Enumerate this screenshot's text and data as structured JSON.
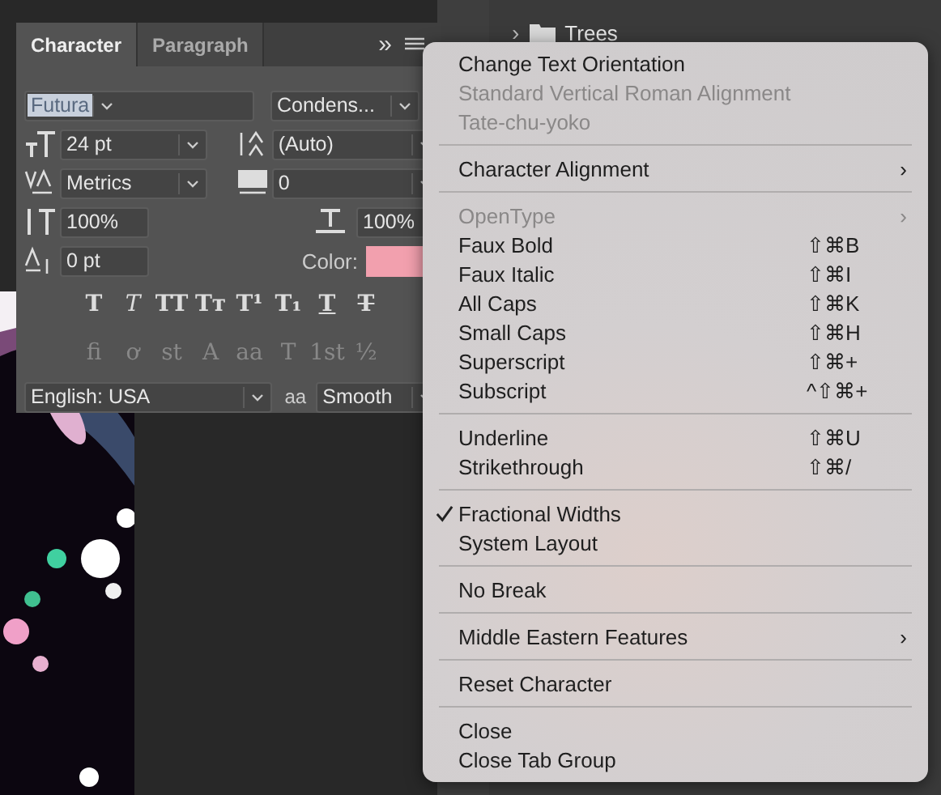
{
  "layers": {
    "rows": [
      {
        "label": "Trees",
        "chevron": "›"
      }
    ]
  },
  "character_panel": {
    "tabs": [
      {
        "label": "Character",
        "selected": true
      },
      {
        "label": "Paragraph",
        "selected": false
      }
    ],
    "overflow": "»",
    "font_family": {
      "value": "Futura",
      "text_selected": true
    },
    "font_style": {
      "value": "Condens..."
    },
    "size": {
      "value": "24 pt"
    },
    "leading": {
      "value": "(Auto)"
    },
    "kerning": {
      "value": "Metrics"
    },
    "tracking": {
      "value": "0"
    },
    "vertical_scale": {
      "value": "100%"
    },
    "horizontal_scale": {
      "value": "100%"
    },
    "baseline_shift": {
      "value": "0 pt"
    },
    "color": {
      "label": "Color:",
      "color": "#f2a0ae"
    },
    "style_buttons": [
      {
        "kind": "bold",
        "text": "T"
      },
      {
        "kind": "italic",
        "text": "T"
      },
      {
        "kind": "caps",
        "text": "TT"
      },
      {
        "kind": "smallcaps",
        "text": "Tт"
      },
      {
        "kind": "super",
        "text": "T¹"
      },
      {
        "kind": "sub",
        "text": "T₁"
      },
      {
        "kind": "underline",
        "text": "T"
      },
      {
        "kind": "strike",
        "text": "T"
      }
    ],
    "opentype_buttons": [
      {
        "text": "fi",
        "disabled": true
      },
      {
        "text": "ơ",
        "disabled": true
      },
      {
        "text": "st",
        "disabled": true
      },
      {
        "text": "A",
        "disabled": true
      },
      {
        "text": "aa",
        "disabled": true
      },
      {
        "text": "T",
        "disabled": true
      },
      {
        "text": "1st",
        "disabled": true
      },
      {
        "text": "½",
        "disabled": true
      }
    ],
    "language": {
      "value": "English: USA"
    },
    "antialias_label": "aa",
    "antialias": {
      "value": "Smooth"
    }
  },
  "menu": {
    "sections": [
      [
        {
          "label": "Change Text Orientation",
          "disabled": false,
          "checked": false
        },
        {
          "label": "Standard Vertical Roman Alignment",
          "disabled": true,
          "checked": false
        },
        {
          "label": "Tate-chu-yoko",
          "disabled": true,
          "checked": false
        }
      ],
      [
        {
          "label": "Character Alignment",
          "disabled": false,
          "checked": false,
          "submenu": "›"
        }
      ],
      [
        {
          "label": "OpenType",
          "disabled": true,
          "checked": false,
          "submenu": "›"
        },
        {
          "label": "Faux Bold",
          "disabled": false,
          "checked": false,
          "shortcut": "⇧⌘B"
        },
        {
          "label": "Faux Italic",
          "disabled": false,
          "checked": false,
          "shortcut": "⇧⌘I"
        },
        {
          "label": "All Caps",
          "disabled": false,
          "checked": false,
          "shortcut": "⇧⌘K"
        },
        {
          "label": "Small Caps",
          "disabled": false,
          "checked": false,
          "shortcut": "⇧⌘H"
        },
        {
          "label": "Superscript",
          "disabled": false,
          "checked": false,
          "shortcut": "⇧⌘+"
        },
        {
          "label": "Subscript",
          "disabled": false,
          "checked": false,
          "shortcut": "^⇧⌘+"
        }
      ],
      [
        {
          "label": "Underline",
          "disabled": false,
          "checked": false,
          "shortcut": "⇧⌘U"
        },
        {
          "label": "Strikethrough",
          "disabled": false,
          "checked": false,
          "shortcut": "⇧⌘/"
        }
      ],
      [
        {
          "label": "Fractional Widths",
          "disabled": false,
          "checked": true
        },
        {
          "label": "System Layout",
          "disabled": false,
          "checked": false
        }
      ],
      [
        {
          "label": "No Break",
          "disabled": false,
          "checked": false
        }
      ],
      [
        {
          "label": "Middle Eastern Features",
          "disabled": false,
          "checked": false,
          "submenu": "›"
        }
      ],
      [
        {
          "label": "Reset Character",
          "disabled": false,
          "checked": false
        }
      ],
      [
        {
          "label": "Close",
          "disabled": false,
          "checked": false
        },
        {
          "label": "Close Tab Group",
          "disabled": false,
          "checked": false
        }
      ]
    ]
  }
}
